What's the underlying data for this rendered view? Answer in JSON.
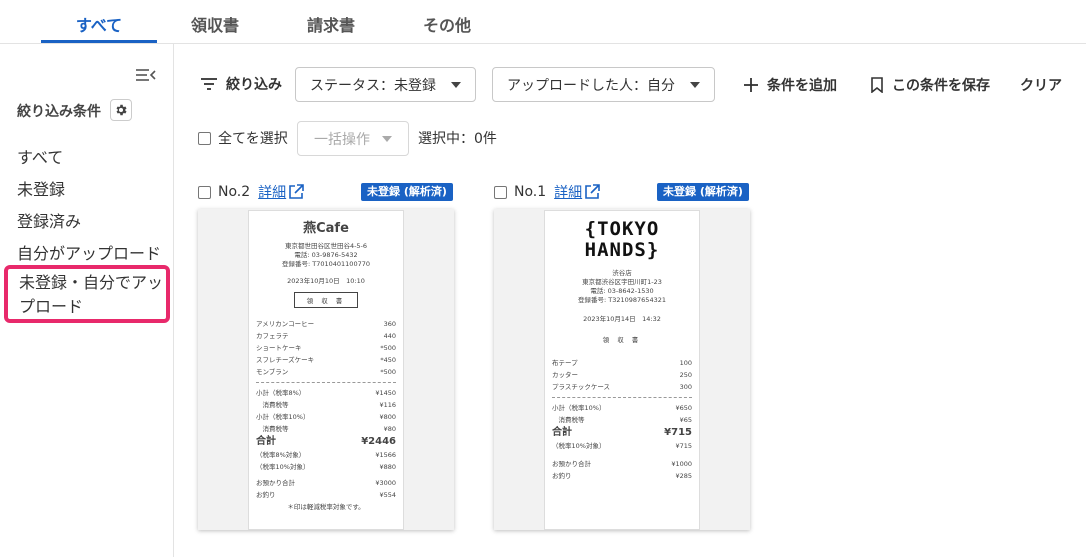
{
  "tabs": [
    "すべて",
    "領収書",
    "請求書",
    "その他"
  ],
  "sidebar": {
    "heading": "絞り込み条件",
    "items": [
      "すべて",
      "未登録",
      "登録済み",
      "自分がアップロード",
      "未登録・自分でアップロード"
    ]
  },
  "toolbar": {
    "filter_label": "絞り込み",
    "status_dropdown": "ステータス：未登録",
    "uploader_dropdown": "アップロードした人：自分",
    "add_condition": "条件を追加",
    "save_condition": "この条件を保存",
    "clear": "クリア"
  },
  "selection": {
    "select_all": "全てを選択",
    "bulk_action": "一括操作",
    "selected_count": "選択中：0件"
  },
  "cards": [
    {
      "number": "No.2",
      "detail": "詳細",
      "badge": "未登録 (解析済)",
      "receipt": {
        "store": "燕Cafe",
        "address": "東京都世田谷区世田谷4-5-6",
        "phone": "電話: 03-9876-5432",
        "reg": "登録番号: T7010401100770",
        "datetime": "2023年10月10日　10:10",
        "doc_title": "領 収 書",
        "items": [
          {
            "name": "アメリカンコーヒー",
            "price": "360"
          },
          {
            "name": "カフェラテ",
            "price": "440"
          },
          {
            "name": "ショートケーキ",
            "price": "*500"
          },
          {
            "name": "スフレチーズケーキ",
            "price": "*450"
          },
          {
            "name": "モンブラン",
            "price": "*500"
          }
        ],
        "subtotals": [
          {
            "name": "小計（税率8%）",
            "price": "¥1450"
          },
          {
            "name": "　消費税等",
            "price": "¥116"
          },
          {
            "name": "小計（税率10%）",
            "price": "¥800"
          },
          {
            "name": "　消費税等",
            "price": "¥80"
          }
        ],
        "total_label": "合計",
        "total": "¥2446",
        "breakdown": [
          {
            "name": "（税率8%対象）",
            "price": "¥1566"
          },
          {
            "name": "（税率10%対象）",
            "price": "¥880"
          }
        ],
        "payment": [
          {
            "name": "お預かり合計",
            "price": "¥3000"
          },
          {
            "name": "お釣り",
            "price": "¥554"
          }
        ],
        "note": "＊印は軽減税率対象です。"
      }
    },
    {
      "number": "No.1",
      "detail": "詳細",
      "badge": "未登録 (解析済)",
      "receipt": {
        "logo_line1": "{TOKYO",
        "logo_line2": "HANDS}",
        "branch": "渋谷店",
        "address": "東京都渋谷区宇田川町1-23",
        "phone": "電話: 03-8642-1530",
        "reg": "登録番号: T3210987654321",
        "datetime": "2023年10月14日　14:32",
        "doc_title": "領 収 書",
        "items": [
          {
            "name": "布テープ",
            "price": "100"
          },
          {
            "name": "カッター",
            "price": "250"
          },
          {
            "name": "プラスチックケース",
            "price": "300"
          }
        ],
        "subtotals": [
          {
            "name": "小計（税率10%）",
            "price": "¥650"
          },
          {
            "name": "　消費税等",
            "price": "¥65"
          }
        ],
        "total_label": "合計",
        "total": "¥715",
        "breakdown": [
          {
            "name": "（税率10%対象）",
            "price": "¥715"
          }
        ],
        "payment": [
          {
            "name": "お預かり合計",
            "price": "¥1000"
          },
          {
            "name": "お釣り",
            "price": "¥285"
          }
        ]
      }
    }
  ]
}
